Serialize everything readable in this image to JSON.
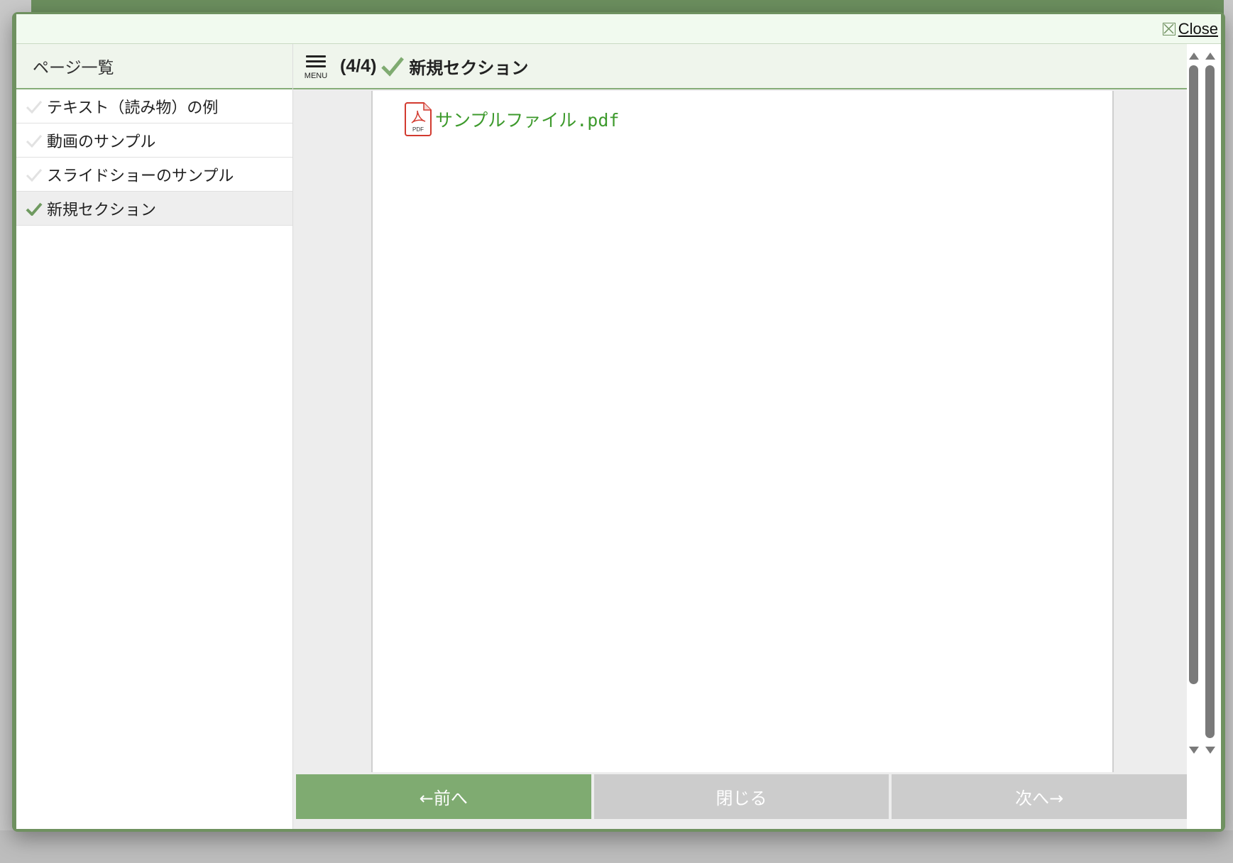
{
  "topbar": {
    "close_label": "Close"
  },
  "sidebar": {
    "header": "ページ一覧",
    "items": [
      {
        "label": "テキスト（読み物）の例",
        "completed": false
      },
      {
        "label": "動画のサンプル",
        "completed": false
      },
      {
        "label": "スライドショーのサンプル",
        "completed": false
      },
      {
        "label": "新規セクション",
        "completed": true,
        "active": true
      }
    ]
  },
  "header": {
    "menu_label": "MENU",
    "page_counter": "(4/4)",
    "title": "新規セクション"
  },
  "content": {
    "pdf_icon_label": "PDF",
    "file_link": "サンプルファイル.pdf"
  },
  "nav": {
    "prev": "←前へ",
    "close": "閉じる",
    "next": "次へ→"
  },
  "colors": {
    "accent": "#7fab71",
    "link": "#3d9a2c",
    "frame": "#6f9160",
    "disabled": "#cccccc"
  }
}
